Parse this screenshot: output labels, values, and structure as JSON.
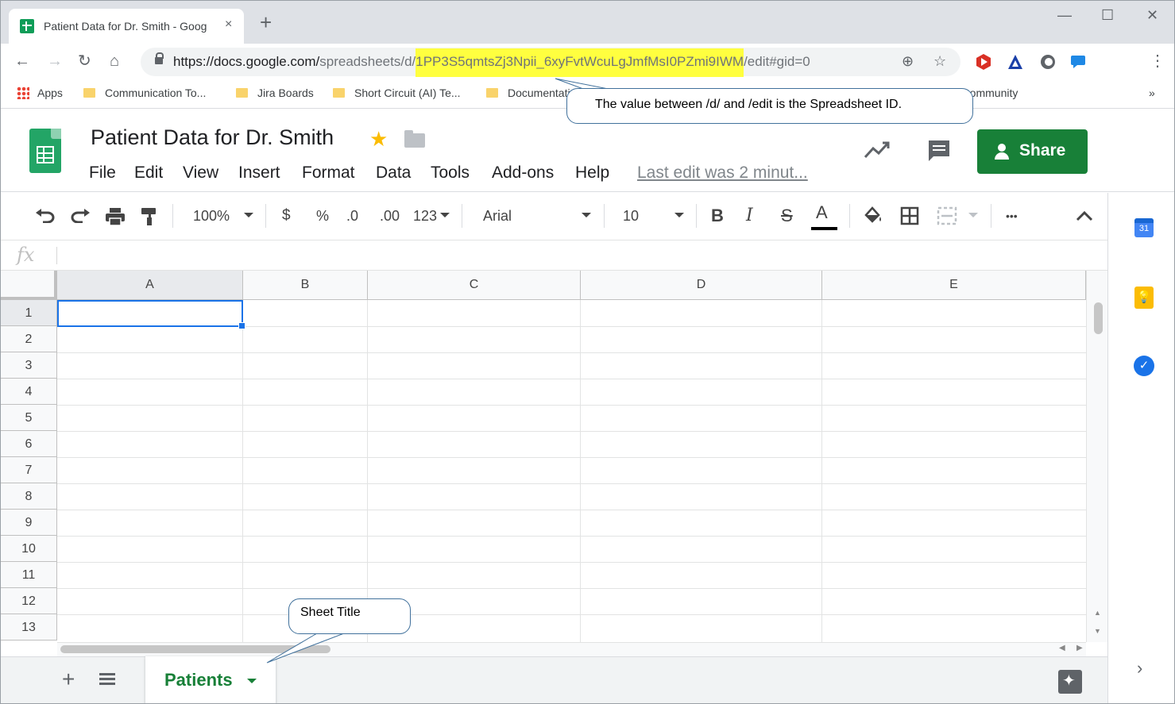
{
  "browser": {
    "tab_title": "Patient Data for Dr. Smith - Goog",
    "tab_close": "×",
    "new_tab": "+",
    "window_controls": {
      "minimize": "—",
      "maximize": "☐",
      "close": "✕"
    },
    "url": {
      "prefix": "https://docs.google.com/",
      "path": "spreadsheets/d/",
      "id": "1PP3S5qmtsZj3Npii_6xyFvtWcuLgJmfMsI0PZmi9IWM",
      "suffix": "/edit#gid=0"
    },
    "bookmarks": [
      {
        "label": "Apps",
        "icon": "apps-grid-icon"
      },
      {
        "label": "Communication To...",
        "icon": "folder-icon"
      },
      {
        "label": "Jira Boards",
        "icon": "folder-icon"
      },
      {
        "label": "Short Circuit (AI) Te...",
        "icon": "folder-icon"
      },
      {
        "label": "Documentation",
        "icon": "folder-icon"
      },
      {
        "label": "BOOMI Community",
        "icon": "folder-icon"
      }
    ],
    "bookmarks_overflow": "»"
  },
  "callouts": {
    "spreadsheet_id": "The value between /d/ and /edit is the Spreadsheet ID.",
    "sheet_title": "Sheet Title"
  },
  "sheets": {
    "doc_title": "Patient Data for Dr. Smith",
    "menu": [
      "File",
      "Edit",
      "View",
      "Insert",
      "Format",
      "Data",
      "Tools",
      "Add-ons",
      "Help"
    ],
    "last_edit": "Last edit was 2 minut...",
    "share_label": "Share",
    "share_color": "#188038",
    "toolbar": {
      "zoom": "100%",
      "currency": "$",
      "percent": "%",
      "dec_decrease": ".0",
      "dec_increase": ".00",
      "more_formats": "123",
      "font": "Arial",
      "font_size": "10",
      "bold": "B",
      "italic": "I",
      "strike": "S",
      "text_color": "A",
      "more": "•••"
    },
    "formula_label": "fx",
    "columns": [
      "A",
      "B",
      "C",
      "D",
      "E"
    ],
    "rows": [
      "1",
      "2",
      "3",
      "4",
      "5",
      "6",
      "7",
      "8",
      "9",
      "10",
      "11",
      "12",
      "13"
    ],
    "sheet_tab": "Patients",
    "side_panel": {
      "calendar": "31"
    }
  }
}
